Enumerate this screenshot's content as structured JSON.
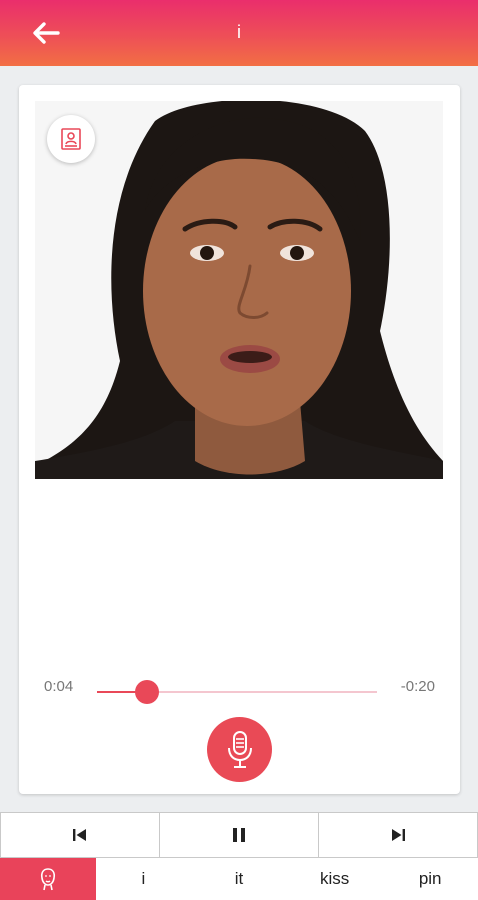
{
  "header": {
    "title": "i",
    "back_icon": "arrow-left-icon"
  },
  "player": {
    "elapsed": "0:04",
    "remaining": "-0:20",
    "progress": 0.18,
    "accent_color": "#e94858",
    "profile_icon": "person-card-icon",
    "mic_icon": "microphone-icon"
  },
  "controls": [
    {
      "name": "previous",
      "icon": "skip-previous-icon"
    },
    {
      "name": "pause",
      "icon": "pause-icon"
    },
    {
      "name": "next",
      "icon": "skip-next-icon"
    }
  ],
  "word_tabs": {
    "active_icon": "face-outline-icon",
    "words": [
      "i",
      "it",
      "kiss",
      "pin"
    ]
  }
}
